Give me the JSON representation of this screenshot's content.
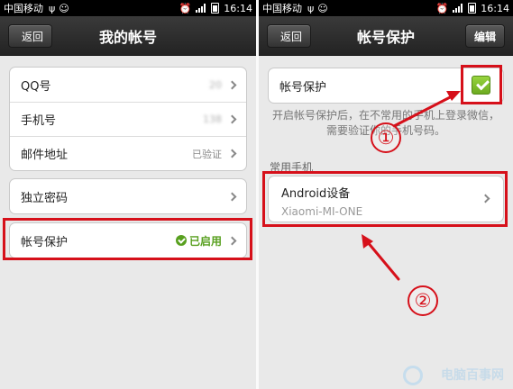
{
  "left": {
    "status": {
      "carrier": "中国移动",
      "time": "16:14"
    },
    "title": "我的帐号",
    "back_label": "返回",
    "group1": [
      {
        "label": "QQ号",
        "value": "20"
      },
      {
        "label": "手机号",
        "value": "138"
      },
      {
        "label": "邮件地址",
        "value": "已验证"
      }
    ],
    "group2": [
      {
        "label": "独立密码"
      }
    ],
    "group3": [
      {
        "label": "帐号保护",
        "status": "已启用"
      }
    ]
  },
  "right": {
    "status": {
      "carrier": "中国移动",
      "time": "16:14"
    },
    "title": "帐号保护",
    "back_label": "返回",
    "edit_label": "编辑",
    "toggle_label": "帐号保护",
    "toggle_checked": true,
    "help_text": "开启帐号保护后，在不常用的手机上登录微信，需要验证你的手机号码。",
    "section_label": "常用手机",
    "device_name": "Android设备",
    "device_model": "Xiaomi-MI-ONE",
    "marker1": "①",
    "marker2": "②"
  },
  "watermark": "电脑百事网",
  "colors": {
    "annotation": "#d6101a",
    "enabled": "#58a01f",
    "titlebar": "#2b2b2b"
  }
}
